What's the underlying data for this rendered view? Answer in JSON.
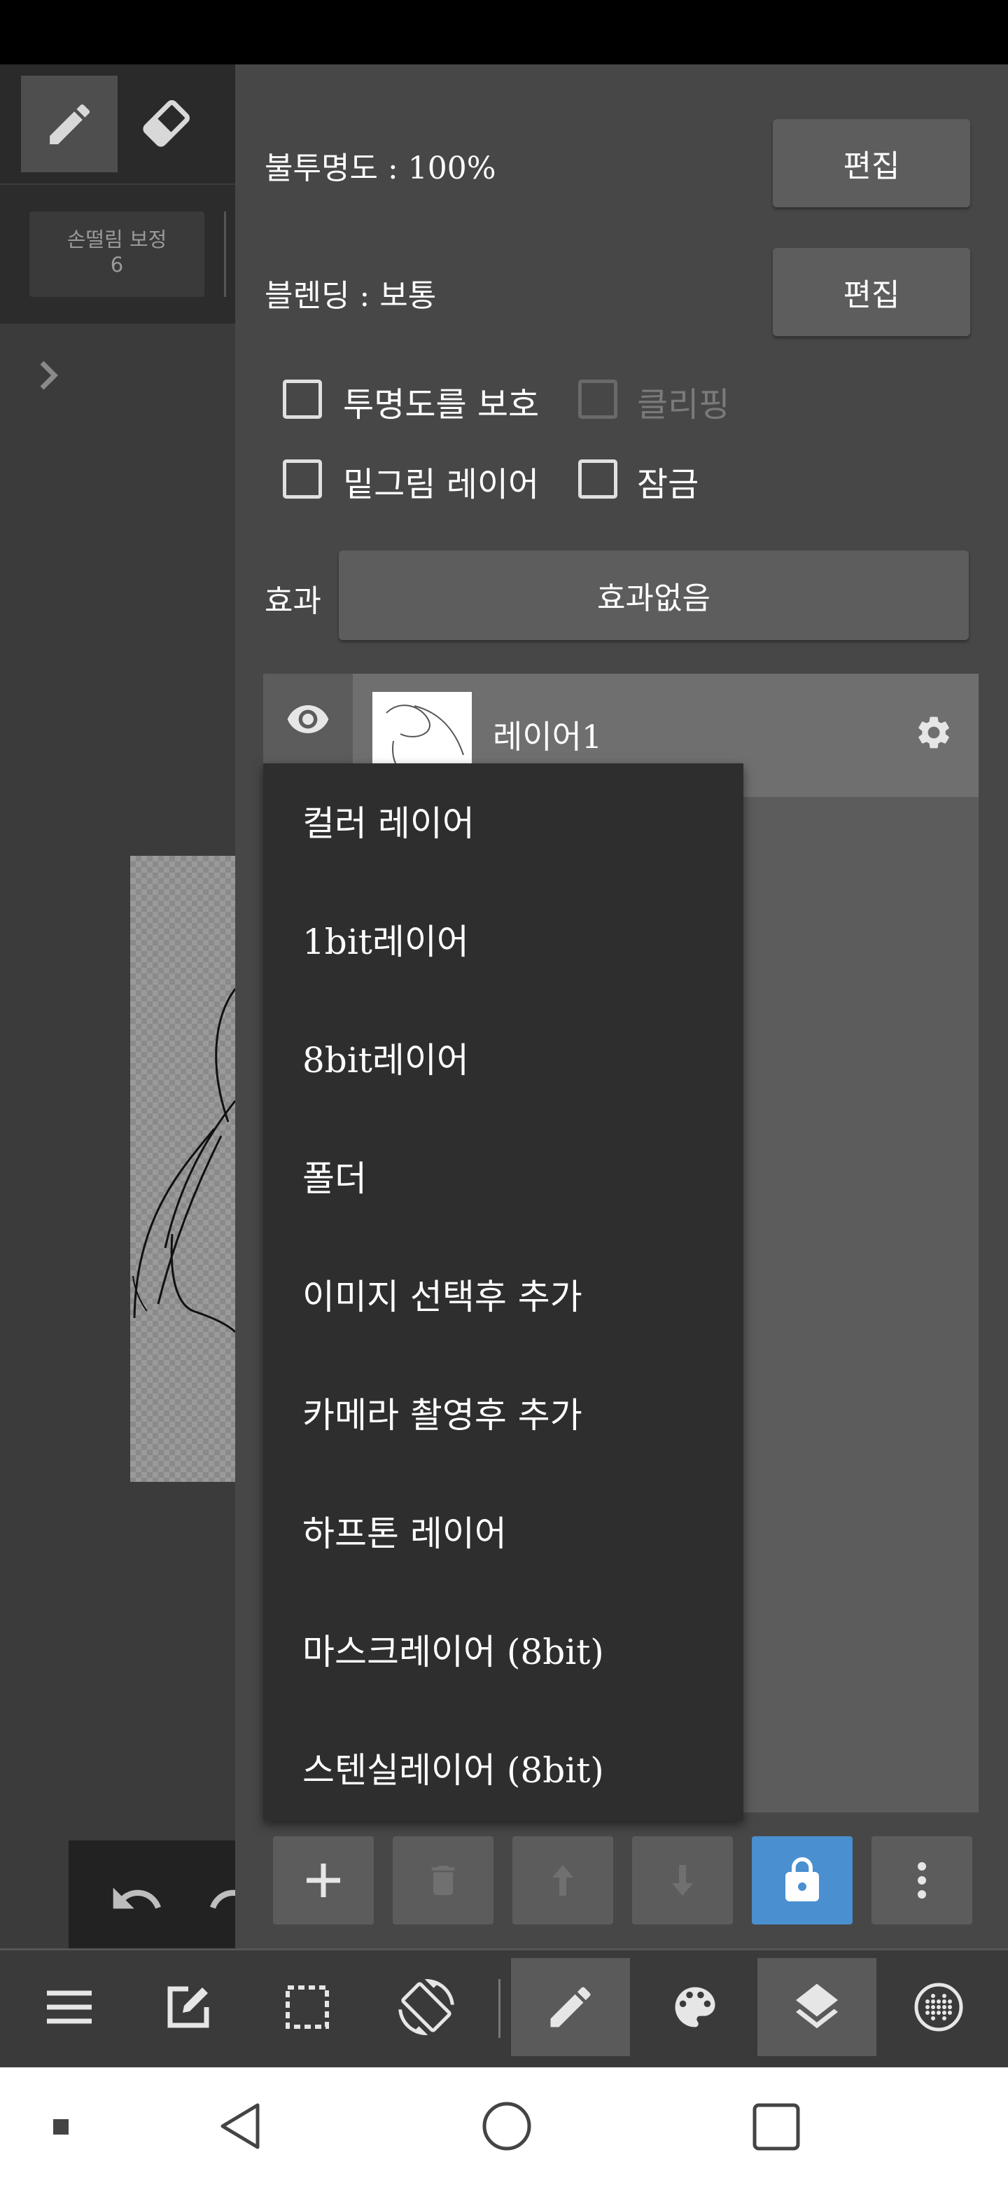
{
  "panel": {
    "opacity_label": "불투명도 : 100%",
    "opacity_edit": "편집",
    "blend_label": "블렌딩 : 보통",
    "blend_edit": "편집",
    "protect_alpha": "투명도를 보호",
    "clipping": "클리핑",
    "draft_layer": "밑그림 레이어",
    "lock": "잠금",
    "effect_label": "효과",
    "effect_value": "효과없음"
  },
  "stabilizer": {
    "label": "손떨림 보정",
    "value": "6"
  },
  "layers": [
    {
      "name": "레이어1",
      "visible": true
    }
  ],
  "add_menu": {
    "items": [
      "컬러 레이어",
      "1bit레이어",
      "8bit레이어",
      "폴더",
      "이미지 선택후 추가",
      "카메라 촬영후 추가",
      "하프톤 레이어",
      "마스크레이어 (8bit)",
      "스텐실레이어 (8bit)"
    ]
  },
  "layer_buttons": [
    "add",
    "delete",
    "move-up",
    "move-down",
    "lock",
    "more"
  ],
  "bottom_toolbar": [
    "menu",
    "edit",
    "selection",
    "rotate",
    "brush",
    "color",
    "layers",
    "material"
  ],
  "colors": {
    "panel": "#474747",
    "menu": "#2e2e2e",
    "lock_active": "#4a8fcf",
    "status_bar": "#000000"
  }
}
